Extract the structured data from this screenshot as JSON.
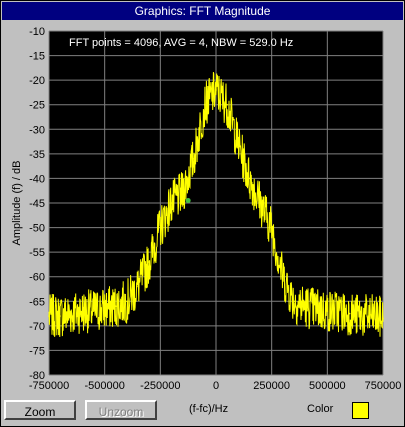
{
  "window": {
    "title": "Graphics: FFT Magnitude"
  },
  "plot": {
    "info_text": "FFT points = 4096, AVG = 4, NBW = 529.0 Hz",
    "trace_color": "#ffff00",
    "marker_color": "#40c040",
    "background_color": "#000000",
    "grid_color": "#808080"
  },
  "chart_data": {
    "type": "line",
    "title": "",
    "xlabel": "(f-fc)/Hz",
    "ylabel": "Amplitude (f) / dB",
    "xlim": [
      -750000,
      750000
    ],
    "ylim": [
      -80,
      -10
    ],
    "x_ticks": [
      "-750000",
      "-500000",
      "-250000",
      "0",
      "250000",
      "500000",
      "750000"
    ],
    "y_ticks": [
      "-10",
      "-15",
      "-20",
      "-25",
      "-30",
      "-35",
      "-40",
      "-45",
      "-50",
      "-55",
      "-60",
      "-65",
      "-70",
      "-75",
      "-80"
    ],
    "grid": true,
    "series": [
      {
        "x": [
          -750000,
          -700000,
          -650000,
          -600000,
          -550000,
          -500000,
          -450000,
          -400000,
          -350000,
          -300000,
          -250000,
          -200000,
          -150000,
          -100000,
          -50000,
          0,
          50000,
          100000,
          150000,
          200000,
          250000,
          300000,
          350000,
          400000,
          450000,
          500000,
          550000,
          600000,
          650000,
          700000,
          750000
        ],
        "y": [
          -68,
          -68,
          -67.5,
          -67,
          -67,
          -66.5,
          -66,
          -65,
          -62,
          -57,
          -50,
          -45,
          -43,
          -36,
          -25,
          -22,
          -25,
          -33,
          -40,
          -45,
          -50,
          -60,
          -65,
          -66,
          -66.5,
          -67,
          -67,
          -67.5,
          -68,
          -68,
          -68.5
        ]
      }
    ],
    "marker": {
      "x": -125000,
      "y": -44.5
    }
  },
  "footer": {
    "zoom_label": "Zoom",
    "unzoom_label": "Unzoom",
    "xlabel": "(f-fc)/Hz",
    "color_label": "Color",
    "color_value": "#ffff00"
  }
}
